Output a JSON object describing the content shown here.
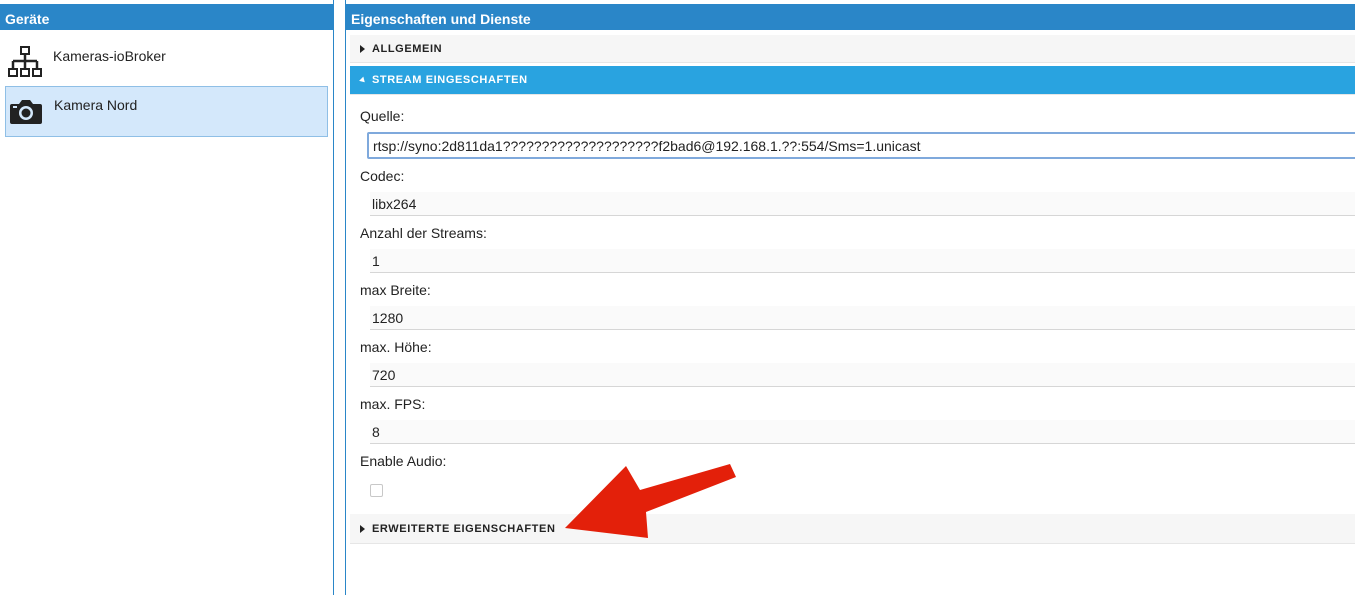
{
  "left": {
    "header": "Geräte",
    "items": [
      {
        "label": "Kameras-ioBroker",
        "icon": "network-tree-icon",
        "selected": false
      },
      {
        "label": "Kamera Nord",
        "icon": "camera-icon",
        "selected": true
      }
    ]
  },
  "right": {
    "header": "Eigenschaften und Dienste",
    "sections": {
      "general": "ALLGEMEIN",
      "stream": "STREAM EINGESCHAFTEN",
      "advanced": "ERWEITERTE EIGENSCHAFTEN"
    },
    "fields": {
      "source": {
        "label": "Quelle:",
        "value": "rtsp://syno:2d811da1????????????????????f2bad6@192.168.1.??:554/Sms=1.unicast"
      },
      "codec": {
        "label": "Codec:",
        "value": "libx264"
      },
      "streams": {
        "label": "Anzahl der Streams:",
        "value": "1"
      },
      "max_width": {
        "label": "max Breite:",
        "value": "1280"
      },
      "max_height": {
        "label": "max. Höhe:",
        "value": "720"
      },
      "max_fps": {
        "label": "max. FPS:",
        "value": "8"
      },
      "audio": {
        "label": "Enable Audio:",
        "checked": false
      }
    }
  },
  "colors": {
    "header_blue": "#2a86c8",
    "section_active": "#29a3e0",
    "annotation_red": "#e3200a"
  }
}
